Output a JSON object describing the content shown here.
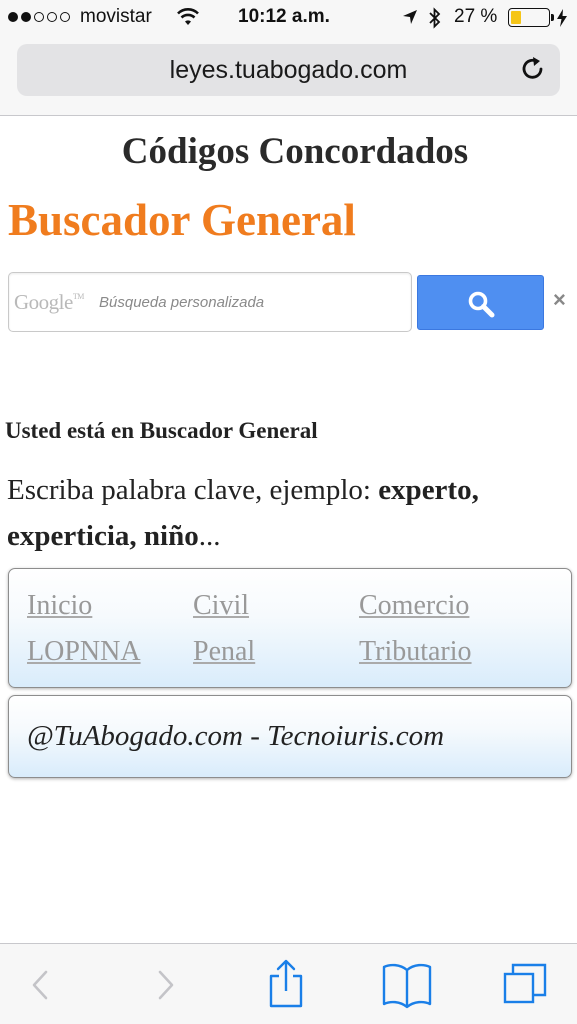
{
  "status_bar": {
    "carrier": "movistar",
    "time": "10:12 a.m.",
    "battery_percent": "27 %",
    "battery_level": 0.27,
    "signal_bars_filled": 2
  },
  "browser": {
    "url": "leyes.tuabogado.com"
  },
  "page": {
    "heading": "Códigos Concordados",
    "search_title": "Buscador General",
    "search": {
      "logo_text": "Google",
      "logo_tm": "TM",
      "placeholder": "Búsqueda personalizada",
      "clear_symbol": "×"
    },
    "location_text": "Usted está en Buscador General",
    "instructions": {
      "prefix": "Escriba palabra clave, ejemplo: ",
      "examples": "experto, experticia, niño",
      "suffix": "..."
    },
    "nav_links": [
      "Inicio",
      "Civil",
      "Comercio",
      "LOPNNA",
      "Penal",
      "Tributario"
    ],
    "footer": "@TuAbogado.com - Tecnoiuris.com"
  },
  "colors": {
    "accent_orange": "#f07c1e",
    "search_button_blue": "#4f8ff1",
    "ios_tint": "#1a7fe8",
    "link_gray": "#999999"
  },
  "icons": {
    "reload": "reload-icon",
    "search": "magnifier-icon",
    "back": "chevron-left-icon",
    "forward": "chevron-right-icon",
    "share": "share-icon",
    "bookmarks": "book-icon",
    "tabs": "tabs-icon"
  }
}
